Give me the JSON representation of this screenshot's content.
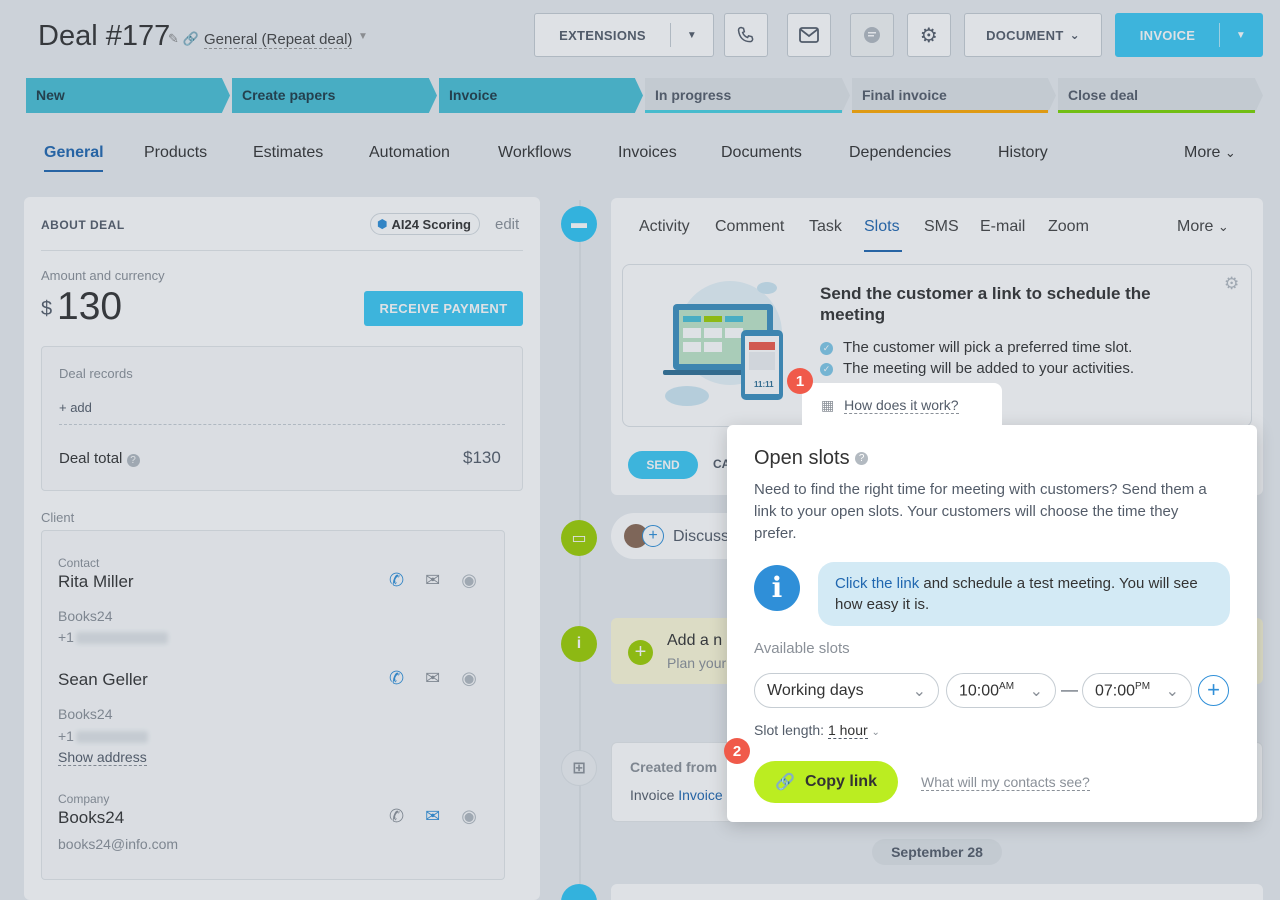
{
  "header": {
    "title": "Deal #177",
    "deal_type": "General (Repeat deal)",
    "extensions_label": "EXTENSIONS",
    "document_label": "DOCUMENT",
    "invoice_label": "INVOICE"
  },
  "stages": [
    {
      "label": "New",
      "state": "active"
    },
    {
      "label": "Create papers",
      "state": "active"
    },
    {
      "label": "Invoice",
      "state": "active"
    },
    {
      "label": "In progress",
      "state": "inactive",
      "color": "#47d1e2"
    },
    {
      "label": "Final invoice",
      "state": "inactive",
      "color": "#ffa900"
    },
    {
      "label": "Close deal",
      "state": "inactive",
      "color": "#7bd500"
    }
  ],
  "tabs": [
    "General",
    "Products",
    "Estimates",
    "Automation",
    "Workflows",
    "Invoices",
    "Documents",
    "Dependencies",
    "History",
    "More"
  ],
  "about": {
    "heading": "ABOUT DEAL",
    "ai_badge": "AI24 Scoring",
    "edit": "edit",
    "amount_label": "Amount and currency",
    "currency": "$",
    "amount": "130",
    "receive_payment": "RECEIVE PAYMENT",
    "deal_records": "Deal records",
    "add": "+ add",
    "deal_total_label": "Deal total",
    "deal_total_value": "$130",
    "client_label": "Client"
  },
  "contacts": {
    "contact_label": "Contact",
    "contact1_name": "Rita Miller",
    "contact1_company": "Books24",
    "contact1_phone": "+1",
    "contact2_name": "Sean Geller",
    "contact2_company": "Books24",
    "contact2_phone": "+1",
    "show_address": "Show address",
    "company_label": "Company",
    "company_name": "Books24",
    "company_email": "books24@info.com"
  },
  "activity_tabs": [
    "Activity",
    "Comment",
    "Task",
    "Slots",
    "SMS",
    "E-mail",
    "Zoom",
    "More"
  ],
  "promo": {
    "title": "Send the customer a link to schedule the meeting",
    "bullet1": "The customer will pick a preferred time slot.",
    "bullet2": "The meeting will be added to your activities.",
    "how_link": "How does it work?",
    "device_time": "11:11"
  },
  "send_label": "SEND",
  "cancel_partial": "CA",
  "discuss_partial": "Discuss",
  "note": {
    "title_partial": "Add a n",
    "sub_partial": "Plan your"
  },
  "created": {
    "title_partial": "Created from",
    "invoice_prefix": "Invoice",
    "invoice_link_partial": "Invoice"
  },
  "popup": {
    "title": "Open slots",
    "desc": "Need to find the right time for meeting with customers? Send them a link to your open slots. Your customers will choose the time they prefer.",
    "info_link": "Click the link",
    "info_rest": " and schedule a test meeting. You will see how easy it is.",
    "available_label": "Available slots",
    "days_value": "Working days",
    "from_time": "10:00",
    "from_ampm": "AM",
    "dash": "—",
    "to_time": "07:00",
    "to_ampm": "PM",
    "slot_length_label": "Slot length:",
    "slot_length_value": "1 hour",
    "copy_link": "Copy link",
    "what_see": "What will my contacts see?"
  },
  "badges": {
    "one": "1",
    "two": "2"
  },
  "date_pill": "September 28",
  "colors": {
    "accent": "#3bc8f5",
    "link": "#2067b0",
    "green": "#bbed21",
    "badge": "#f05a4a"
  }
}
